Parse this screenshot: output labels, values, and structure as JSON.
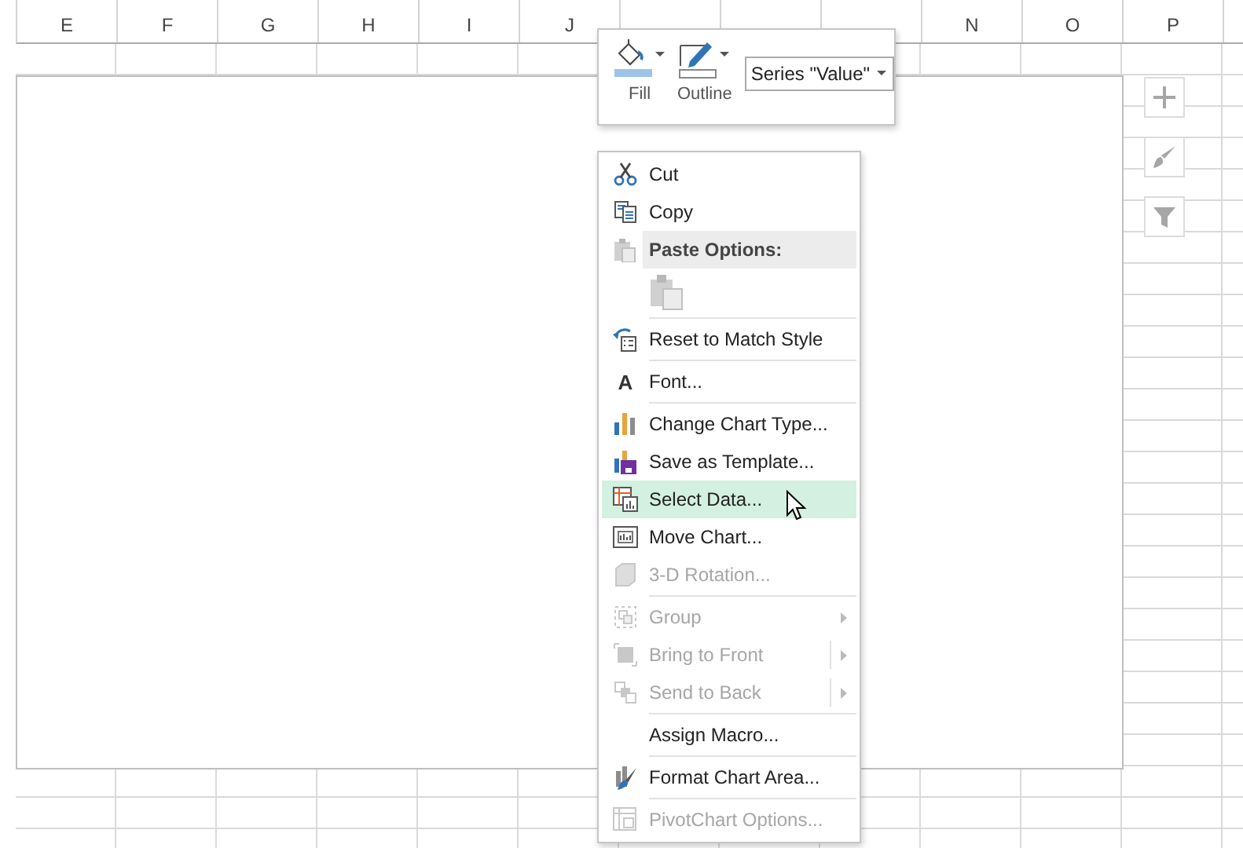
{
  "columns_left": [
    "E",
    "F",
    "G",
    "H",
    "I",
    "J"
  ],
  "columns_right": [
    "N",
    "O",
    "P"
  ],
  "mini_toolbar": {
    "buttons": [
      {
        "label": "Fill"
      },
      {
        "label": "Outline"
      }
    ],
    "series_select": {
      "value": "Series \"Value\""
    }
  },
  "context_menu": {
    "items": [
      {
        "kind": "item",
        "label": "Cut",
        "disabled": false,
        "selected": false
      },
      {
        "kind": "item",
        "label": "Copy",
        "disabled": false,
        "selected": false
      },
      {
        "kind": "header",
        "label": "Paste Options:"
      },
      {
        "kind": "paste_choices"
      },
      {
        "kind": "item",
        "label": "Reset to Match Style",
        "disabled": false,
        "selected": false,
        "separator_before": true
      },
      {
        "kind": "item",
        "glyph": "A",
        "label": "Font...",
        "disabled": false,
        "selected": false,
        "separator_before": true
      },
      {
        "kind": "item",
        "label": "Change Chart Type...",
        "disabled": false,
        "selected": false,
        "separator_before": true
      },
      {
        "kind": "item",
        "label": "Save as Template...",
        "disabled": false,
        "selected": false
      },
      {
        "kind": "item",
        "label": "Select Data...",
        "disabled": false,
        "selected": true
      },
      {
        "kind": "item",
        "label": "Move Chart...",
        "disabled": false,
        "selected": false
      },
      {
        "kind": "item",
        "label": "3-D Rotation...",
        "disabled": true,
        "selected": false
      },
      {
        "kind": "item",
        "label": "Group",
        "disabled": true,
        "selected": false,
        "separator_before": true,
        "submenu": true,
        "split": false
      },
      {
        "kind": "item",
        "label": "Bring to Front",
        "disabled": true,
        "selected": false,
        "submenu": true,
        "split": true
      },
      {
        "kind": "item",
        "label": "Send to Back",
        "disabled": true,
        "selected": false,
        "submenu": true,
        "split": true
      },
      {
        "kind": "item",
        "label": "Assign Macro...",
        "disabled": false,
        "selected": false,
        "separator_before": true
      },
      {
        "kind": "item",
        "label": "Format Chart Area...",
        "disabled": false,
        "selected": false,
        "separator_before": true
      },
      {
        "kind": "item",
        "label": "PivotChart Options...",
        "disabled": true,
        "selected": false,
        "separator_before": true
      }
    ]
  }
}
